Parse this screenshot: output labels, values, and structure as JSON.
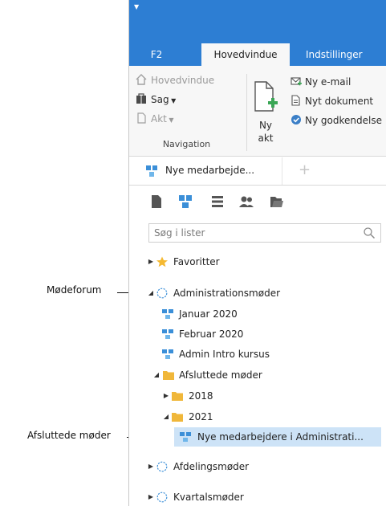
{
  "annotations": {
    "modeforum": "Mødeforum",
    "afsluttede": "Afsluttede møder"
  },
  "tabs": {
    "f2": "F2",
    "home": "Hovedvindue",
    "settings": "Indstillinger"
  },
  "ribbon": {
    "navigation": {
      "home": "Hovedvindue",
      "case": "Sag",
      "record": "Akt",
      "group_label": "Navigation"
    },
    "new_record": {
      "line1": "Ny",
      "line2": "akt"
    },
    "new_email": "Ny e-mail",
    "new_document": "Nyt dokument",
    "new_approval": "Ny godkendelse"
  },
  "list_tab": {
    "label": "Nye medarbejde..."
  },
  "search": {
    "placeholder": "Søg i lister"
  },
  "tree": {
    "favorites": "Favoritter",
    "admin_meetings": "Administrationsmøder",
    "jan_2020": "Januar 2020",
    "feb_2020": "Februar 2020",
    "admin_intro": "Admin Intro kursus",
    "closed_meetings": "Afsluttede møder",
    "y2018": "2018",
    "y2021": "2021",
    "new_employees": "Nye medarbejdere i Administrati...",
    "department_meetings": "Afdelingsmøder",
    "quarterly_meetings": "Kvartalsmøder"
  },
  "colors": {
    "ribbon_blue": "#2d7ed3",
    "selected": "#cde3f7",
    "folder": "#f0b73a",
    "star": "#f5b932",
    "list_icon": "#3b8fd8"
  }
}
